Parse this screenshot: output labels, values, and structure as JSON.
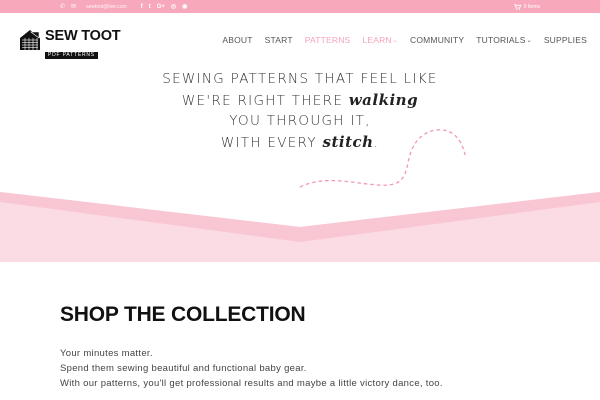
{
  "topbar": {
    "email": "sewtoot@live.com",
    "social_icons": [
      "facebook-icon",
      "twitter-icon",
      "google-plus-icon",
      "instagram-icon",
      "rss-icon"
    ],
    "social_glyphs": [
      "f",
      "t",
      "G+",
      "◎",
      "◉"
    ],
    "cart_label": "0 Items",
    "background": "#f7a8bb"
  },
  "logo": {
    "title": "SEW TOOT",
    "subtitle": "PDF PATTERNS"
  },
  "nav": {
    "items": [
      {
        "label": "ABOUT",
        "active": false,
        "dropdown": false
      },
      {
        "label": "START",
        "active": false,
        "dropdown": false
      },
      {
        "label": "PATTERNS",
        "active": true,
        "dropdown": false
      },
      {
        "label": "LEARN",
        "active": true,
        "dropdown": true
      },
      {
        "label": "COMMUNITY",
        "active": false,
        "dropdown": false
      },
      {
        "label": "TUTORIALS",
        "active": false,
        "dropdown": true
      },
      {
        "label": "SUPPLIES",
        "active": false,
        "dropdown": false
      }
    ],
    "active_color": "#f4a3b7"
  },
  "hero": {
    "line1": "SEWING PATTERNS THAT FEEL LIKE",
    "line2_before": "WE'RE RIGHT THERE ",
    "line2_script": "walking",
    "line3": "YOU THROUGH IT,",
    "line4_before": "WITH EVERY ",
    "line4_script": "stitch",
    "line4_after": ".",
    "band_colors": [
      "#f9c6d3",
      "#f7b5c6",
      "#fbdde5"
    ],
    "dash_color": "#f199ad"
  },
  "collection": {
    "title": "SHOP THE COLLECTION",
    "paragraphs": [
      "Your minutes matter.",
      "Spend them sewing beautiful and functional baby gear.",
      "With our patterns, you'll get professional results and maybe a little victory dance, too."
    ]
  }
}
